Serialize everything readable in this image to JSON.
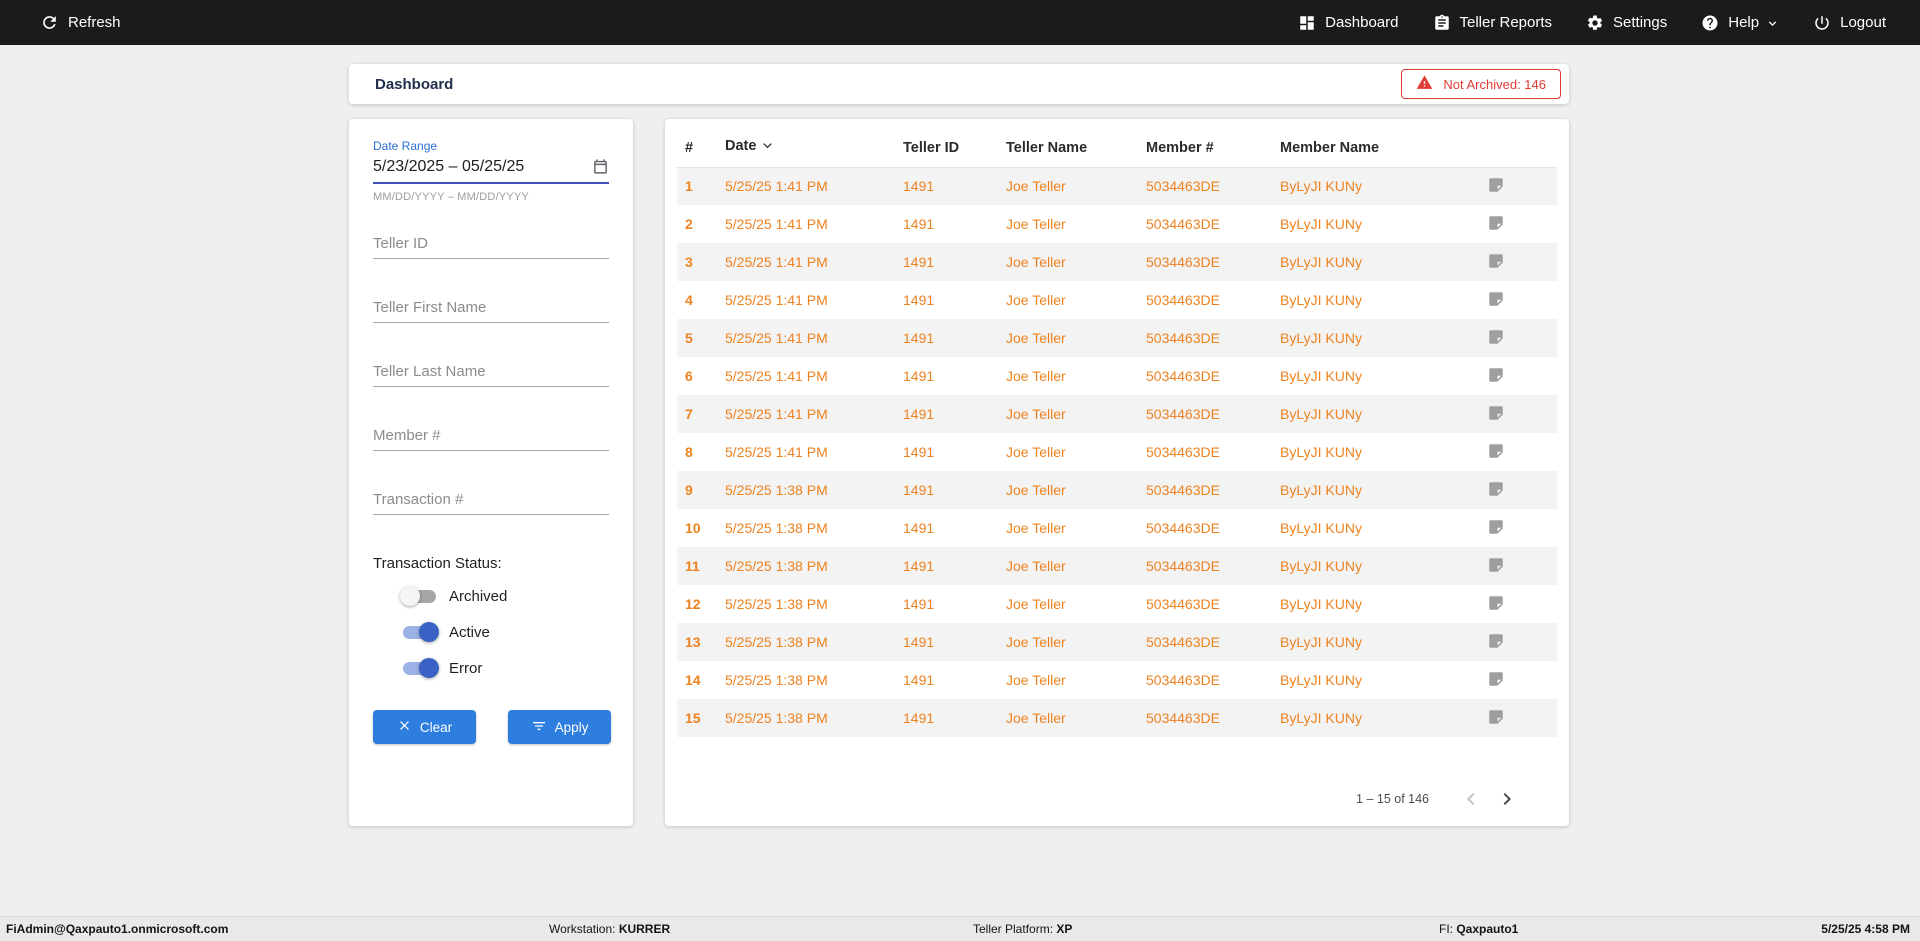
{
  "navbar": {
    "refresh_label": "Refresh",
    "items": [
      {
        "label": "Dashboard"
      },
      {
        "label": "Teller Reports"
      },
      {
        "label": "Settings"
      },
      {
        "label": "Help"
      },
      {
        "label": "Logout"
      }
    ]
  },
  "header": {
    "title": "Dashboard",
    "badge_label": "Not Archived: 146"
  },
  "filters": {
    "date_range_label": "Date Range",
    "date_range_value": "5/23/2025 – 05/25/25",
    "date_range_hint": "MM/DD/YYYY – MM/DD/YYYY",
    "fields": [
      {
        "name": "teller-id",
        "placeholder": "Teller ID"
      },
      {
        "name": "teller-first-name",
        "placeholder": "Teller First Name"
      },
      {
        "name": "teller-last-name",
        "placeholder": "Teller Last Name"
      },
      {
        "name": "member-number",
        "placeholder": "Member #"
      },
      {
        "name": "transaction-number",
        "placeholder": "Transaction #"
      }
    ],
    "status_label": "Transaction Status:",
    "toggles": [
      {
        "label": "Archived",
        "on": false
      },
      {
        "label": "Active",
        "on": true
      },
      {
        "label": "Error",
        "on": true
      }
    ],
    "clear_label": "Clear",
    "apply_label": "Apply"
  },
  "table": {
    "columns": {
      "num": "#",
      "date": "Date",
      "teller_id": "Teller ID",
      "teller_name": "Teller Name",
      "member_num": "Member #",
      "member_name": "Member Name"
    },
    "rows": [
      {
        "num": "1",
        "date": "5/25/25 1:41 PM",
        "teller_id": "1491",
        "teller_name": "Joe Teller",
        "member_num": "5034463DE",
        "member_name": "ByLyJI KUNy"
      },
      {
        "num": "2",
        "date": "5/25/25 1:41 PM",
        "teller_id": "1491",
        "teller_name": "Joe Teller",
        "member_num": "5034463DE",
        "member_name": "ByLyJI KUNy"
      },
      {
        "num": "3",
        "date": "5/25/25 1:41 PM",
        "teller_id": "1491",
        "teller_name": "Joe Teller",
        "member_num": "5034463DE",
        "member_name": "ByLyJI KUNy"
      },
      {
        "num": "4",
        "date": "5/25/25 1:41 PM",
        "teller_id": "1491",
        "teller_name": "Joe Teller",
        "member_num": "5034463DE",
        "member_name": "ByLyJI KUNy"
      },
      {
        "num": "5",
        "date": "5/25/25 1:41 PM",
        "teller_id": "1491",
        "teller_name": "Joe Teller",
        "member_num": "5034463DE",
        "member_name": "ByLyJI KUNy"
      },
      {
        "num": "6",
        "date": "5/25/25 1:41 PM",
        "teller_id": "1491",
        "teller_name": "Joe Teller",
        "member_num": "5034463DE",
        "member_name": "ByLyJI KUNy"
      },
      {
        "num": "7",
        "date": "5/25/25 1:41 PM",
        "teller_id": "1491",
        "teller_name": "Joe Teller",
        "member_num": "5034463DE",
        "member_name": "ByLyJI KUNy"
      },
      {
        "num": "8",
        "date": "5/25/25 1:41 PM",
        "teller_id": "1491",
        "teller_name": "Joe Teller",
        "member_num": "5034463DE",
        "member_name": "ByLyJI KUNy"
      },
      {
        "num": "9",
        "date": "5/25/25 1:38 PM",
        "teller_id": "1491",
        "teller_name": "Joe Teller",
        "member_num": "5034463DE",
        "member_name": "ByLyJI KUNy"
      },
      {
        "num": "10",
        "date": "5/25/25 1:38 PM",
        "teller_id": "1491",
        "teller_name": "Joe Teller",
        "member_num": "5034463DE",
        "member_name": "ByLyJI KUNy"
      },
      {
        "num": "11",
        "date": "5/25/25 1:38 PM",
        "teller_id": "1491",
        "teller_name": "Joe Teller",
        "member_num": "5034463DE",
        "member_name": "ByLyJI KUNy"
      },
      {
        "num": "12",
        "date": "5/25/25 1:38 PM",
        "teller_id": "1491",
        "teller_name": "Joe Teller",
        "member_num": "5034463DE",
        "member_name": "ByLyJI KUNy"
      },
      {
        "num": "13",
        "date": "5/25/25 1:38 PM",
        "teller_id": "1491",
        "teller_name": "Joe Teller",
        "member_num": "5034463DE",
        "member_name": "ByLyJI KUNy"
      },
      {
        "num": "14",
        "date": "5/25/25 1:38 PM",
        "teller_id": "1491",
        "teller_name": "Joe Teller",
        "member_num": "5034463DE",
        "member_name": "ByLyJI KUNy"
      },
      {
        "num": "15",
        "date": "5/25/25 1:38 PM",
        "teller_id": "1491",
        "teller_name": "Joe Teller",
        "member_num": "5034463DE",
        "member_name": "ByLyJI KUNy"
      }
    ],
    "pagination_range": "1 – 15 of 146"
  },
  "statusbar": {
    "user": "FiAdmin@Qaxpauto1.onmicrosoft.com",
    "workstation_label": "Workstation: ",
    "workstation_value": "KURRER",
    "platform_label": "Teller Platform: ",
    "platform_value": "XP",
    "fi_label": "FI: ",
    "fi_value": "Qaxpauto1",
    "datetime": "5/25/25 4:58 PM"
  },
  "icons": {
    "refresh-icon": "circular-arrow",
    "dashboard-icon": "tile-grid",
    "teller-reports-icon": "clipboard",
    "settings-icon": "gear",
    "help-icon": "question-circle",
    "chevron-down-icon": "chevron-down",
    "logout-icon": "power",
    "warning-icon": "red-triangle-exclamation",
    "calendar-icon": "calendar",
    "clear-x-icon": "x",
    "filter-icon": "filter-lines",
    "sort-desc-icon": "chevron-down",
    "note-icon": "sticky-note",
    "prev-page-icon": "chevron-left",
    "next-page-icon": "chevron-right"
  },
  "colors": {
    "navbar_bg": "#1b1b1b",
    "accent_blue": "#2e7ee0",
    "toggle_blue": "#3a62c4",
    "label_blue": "#2a6fd2",
    "underline_blue": "#3f51b5",
    "row_orange": "#ee8220",
    "alert_red": "#e03a34"
  }
}
